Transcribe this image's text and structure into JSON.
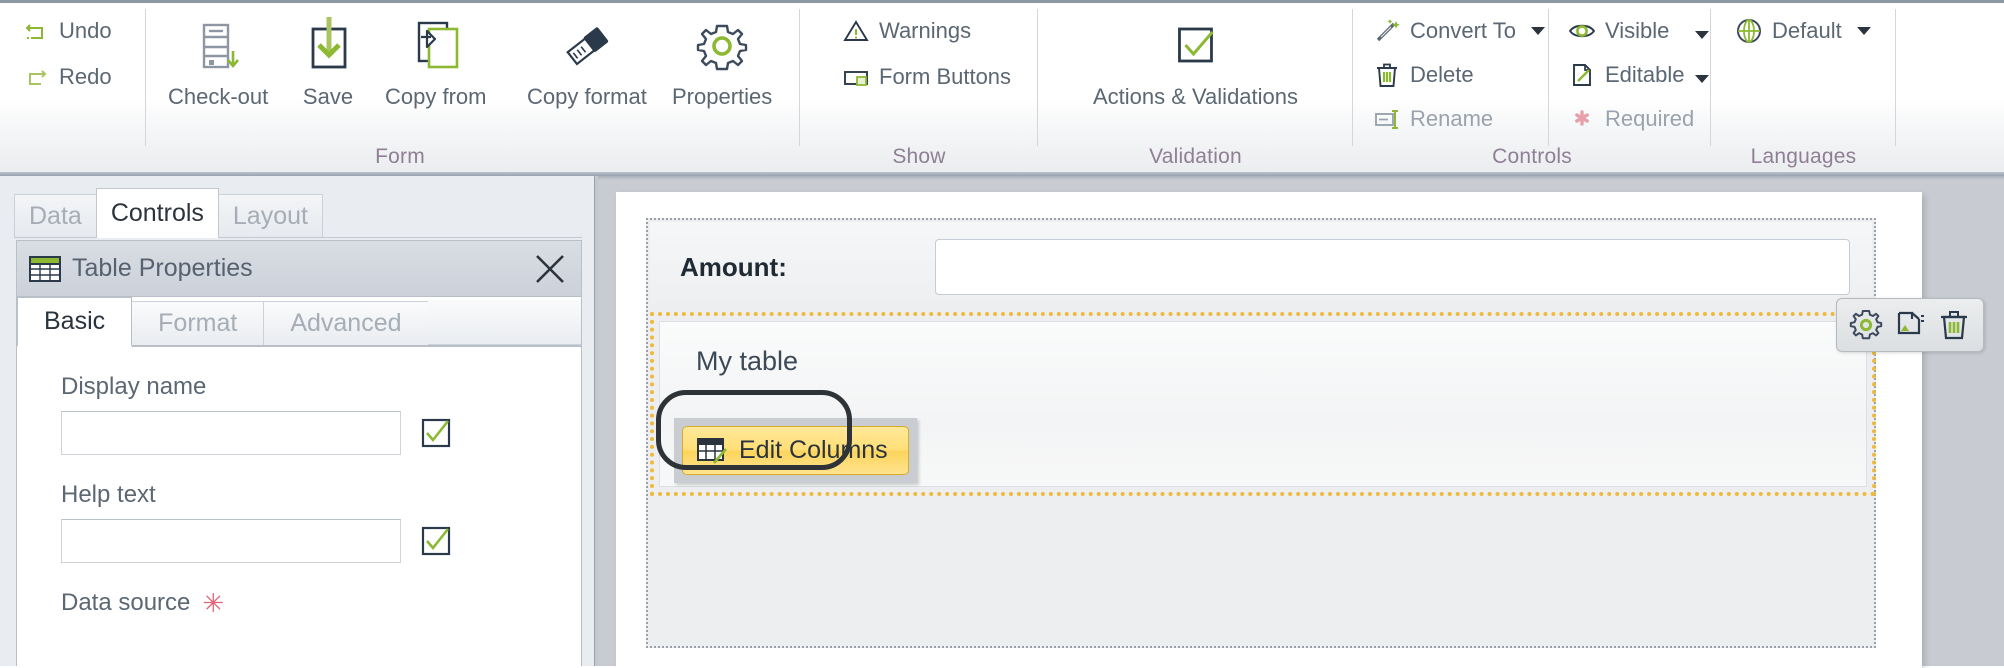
{
  "ribbon": {
    "groups": [
      {
        "name": "Form",
        "label": "Form"
      },
      {
        "name": "Show",
        "label": "Show"
      },
      {
        "name": "Validation",
        "label": "Validation"
      },
      {
        "name": "Controls",
        "label": "Controls"
      },
      {
        "name": "Languages",
        "label": "Languages"
      }
    ],
    "form_group": {
      "undo": "Undo",
      "redo": "Redo",
      "check_out": "Check-out",
      "save": "Save",
      "copy_from": "Copy from",
      "copy_format": "Copy format",
      "properties": "Properties"
    },
    "show_group": {
      "warnings": "Warnings",
      "form_buttons": "Form Buttons"
    },
    "validation_group": {
      "actions_validations": "Actions & Validations"
    },
    "controls_group": {
      "convert_to": "Convert To",
      "delete": "Delete",
      "rename": "Rename",
      "visible": "Visible",
      "editable": "Editable",
      "required": "Required"
    },
    "languages_group": {
      "default": "Default"
    }
  },
  "left_panel": {
    "tabs": [
      {
        "label": "Data",
        "active": false
      },
      {
        "label": "Controls",
        "active": true
      },
      {
        "label": "Layout",
        "active": false
      }
    ],
    "properties_panel": {
      "title": "Table Properties",
      "close_label": "Close",
      "subtabs": [
        {
          "label": "Basic",
          "active": true
        },
        {
          "label": "Format",
          "active": false
        },
        {
          "label": "Advanced",
          "active": false
        }
      ],
      "fields": [
        {
          "label": "Display name",
          "value": "",
          "required": false,
          "checked": true
        },
        {
          "label": "Help text",
          "value": "",
          "required": false,
          "checked": true
        },
        {
          "label": "Data source",
          "value": "",
          "required": true,
          "checked": false
        }
      ],
      "required_marker": "✳"
    }
  },
  "canvas": {
    "amount_label": "Amount:",
    "amount_value": "",
    "table_title": "My table",
    "edit_columns_button": "Edit Columns",
    "mini_toolbar": [
      {
        "name": "gear-icon",
        "title": "Properties"
      },
      {
        "name": "duplicate-icon",
        "title": "Duplicate"
      },
      {
        "name": "trash-icon",
        "title": "Delete"
      }
    ]
  },
  "colors": {
    "accent_green": "#8cb832",
    "dark_navy": "#2b3a4a",
    "group_label": "#8f7f95",
    "selection_orange": "#f0b93c",
    "button_yellow": "#ffdf77",
    "required_red": "#e06377",
    "text_gray": "#5b6773"
  }
}
